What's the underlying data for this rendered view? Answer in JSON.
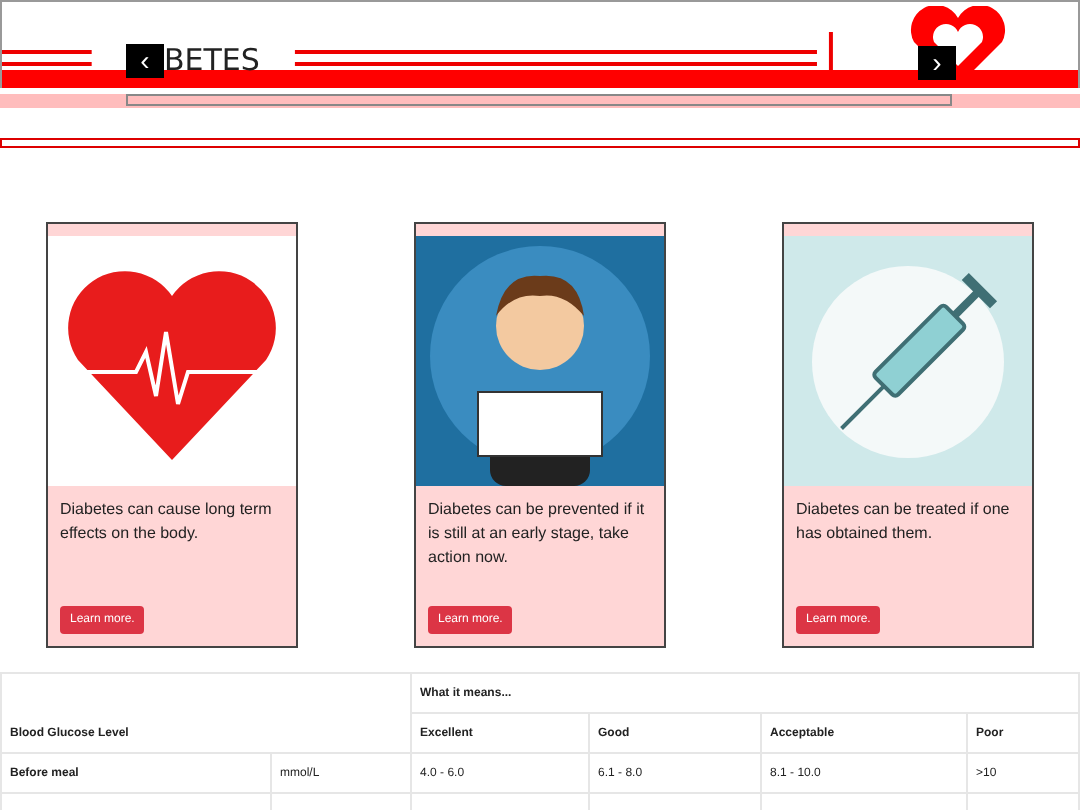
{
  "banner": {
    "title": "BETES",
    "prev": "‹",
    "next": "›"
  },
  "cards": [
    {
      "text": "Diabetes can cause long term effects on the body.",
      "button": "Learn more."
    },
    {
      "text": "Diabetes can be prevented if it is still at an early stage, take action now.",
      "button": "Learn more."
    },
    {
      "text": "Diabetes can be treated if one has obtained them.",
      "button": "Learn more."
    }
  ],
  "table": {
    "group_heading": "What it means...",
    "row_heading": "Blood Glucose Level",
    "columns": [
      "Excellent",
      "Good",
      "Acceptable",
      "Poor"
    ],
    "rows": [
      {
        "label": "Before meal",
        "unit": "mmol/L",
        "cells": [
          "4.0 - 6.0",
          "6.1 - 8.0",
          "8.1 - 10.0",
          ">10"
        ]
      }
    ]
  }
}
